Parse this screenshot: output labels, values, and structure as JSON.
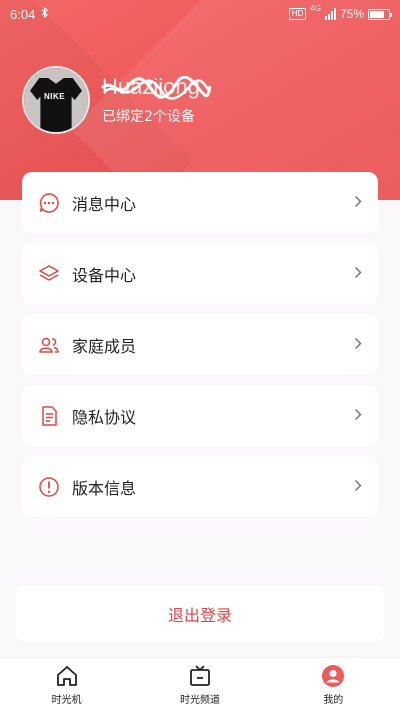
{
  "status_bar": {
    "time": "6:04",
    "bluetooth_icon": "bluetooth-icon",
    "hd_badge": "HD",
    "network": "4G",
    "battery": "75%",
    "battery_level": 0.75
  },
  "profile": {
    "username": "Huazijong",
    "device_status": "已绑定2个设备",
    "avatar_logo": "NIKE"
  },
  "menu": {
    "items": [
      {
        "label": "消息中心",
        "icon": "message-icon"
      },
      {
        "label": "设备中心",
        "icon": "layers-icon"
      },
      {
        "label": "家庭成员",
        "icon": "family-icon"
      },
      {
        "label": "隐私协议",
        "icon": "document-icon"
      },
      {
        "label": "版本信息",
        "icon": "info-icon"
      }
    ]
  },
  "logout_label": "退出登录",
  "tabbar": {
    "tabs": [
      {
        "label": "时光机",
        "icon": "home-icon"
      },
      {
        "label": "时光频道",
        "icon": "tv-icon"
      },
      {
        "label": "我的",
        "icon": "user-icon",
        "active": true
      }
    ]
  },
  "colors": {
    "accent": "#f05a5b",
    "accent_text": "#e24646"
  }
}
